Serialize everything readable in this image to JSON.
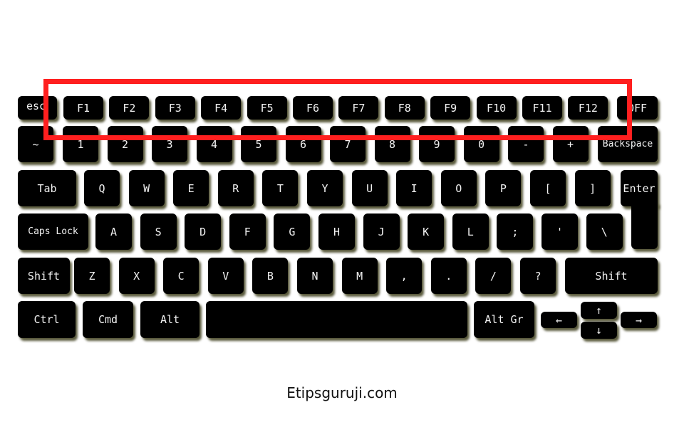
{
  "keyboard": {
    "rows": [
      [
        "esc",
        "F1",
        "F2",
        "F3",
        "F4",
        "F5",
        "F6",
        "F7",
        "F8",
        "F9",
        "F10",
        "F11",
        "F12",
        "OFF"
      ],
      [
        "~",
        "1",
        "2",
        "3",
        "4",
        "5",
        "6",
        "7",
        "8",
        "9",
        "0",
        "-",
        "+",
        "Backspace"
      ],
      [
        "Tab",
        "Q",
        "W",
        "E",
        "R",
        "T",
        "Y",
        "U",
        "I",
        "O",
        "P",
        "[",
        "]",
        "Enter"
      ],
      [
        "Caps Lock",
        "A",
        "S",
        "D",
        "F",
        "G",
        "H",
        "J",
        "K",
        "L",
        ";",
        "'",
        "\\"
      ],
      [
        "Shift",
        "Z",
        "X",
        "C",
        "V",
        "B",
        "N",
        "M",
        ",",
        ".",
        "/",
        "?",
        "Shift"
      ],
      [
        "Ctrl",
        "Cmd",
        "Alt",
        "",
        "Alt Gr",
        "←",
        "↑",
        "↓",
        "→"
      ]
    ]
  },
  "highlight": {
    "target": "function-key-row",
    "color": "#ff1f1f"
  },
  "colors": {
    "key": "#000000",
    "key_text": "#f2f2f2",
    "background": "#ffffff"
  },
  "caption": "Etipsguruji.com"
}
